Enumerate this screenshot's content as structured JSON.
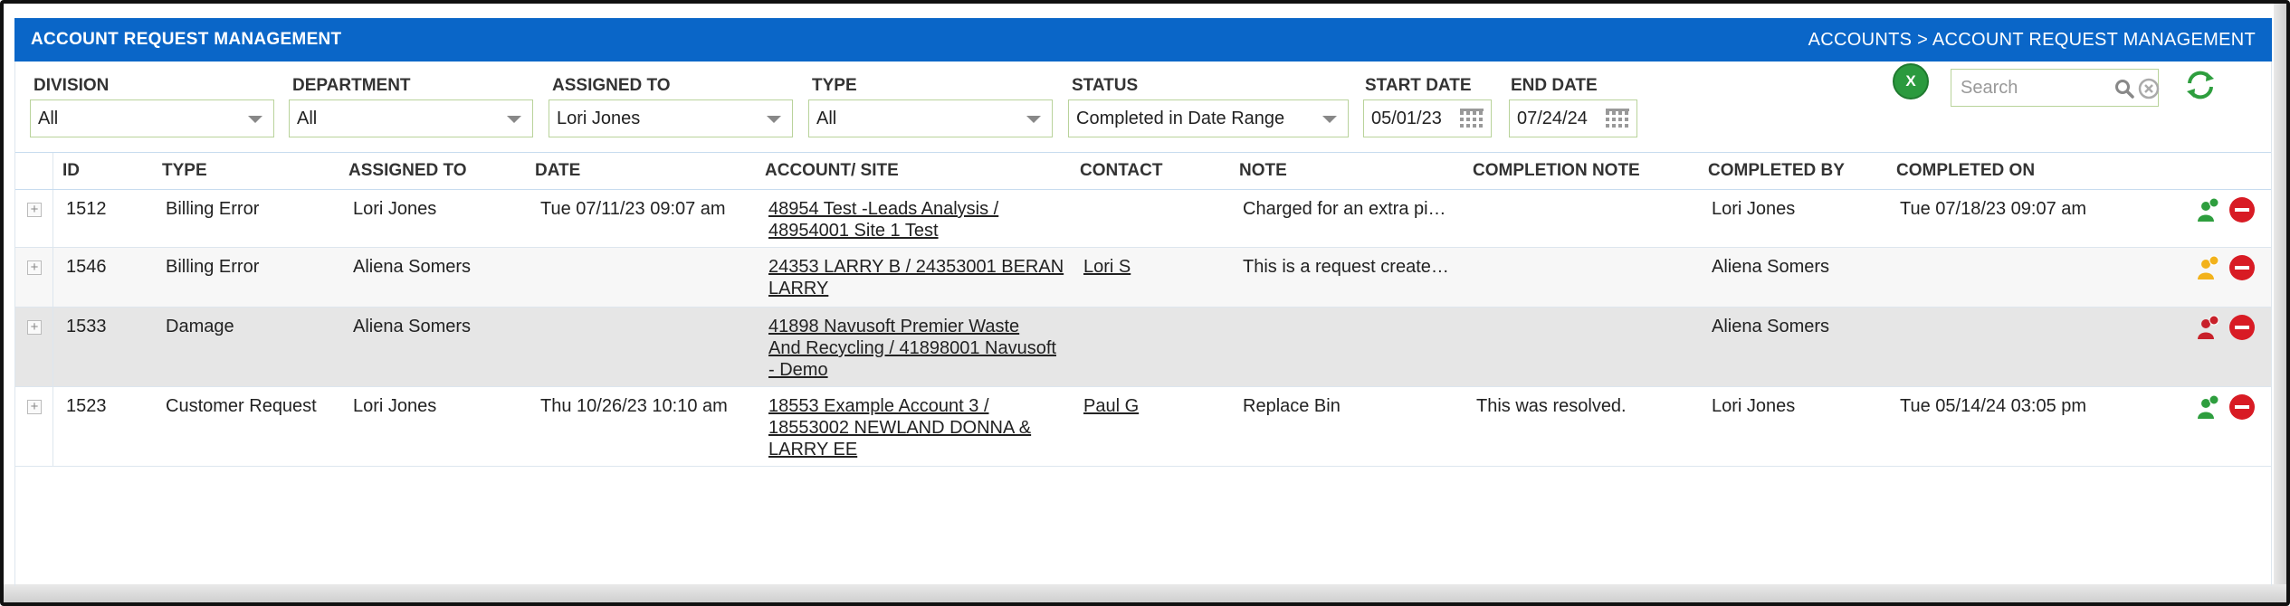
{
  "header": {
    "title": "ACCOUNT REQUEST MANAGEMENT",
    "breadcrumb": [
      "ACCOUNTS",
      ">",
      "ACCOUNT REQUEST MANAGEMENT"
    ]
  },
  "filters": {
    "division": {
      "label": "DIVISION",
      "value": "All"
    },
    "department": {
      "label": "DEPARTMENT",
      "value": "All"
    },
    "assigned_to": {
      "label": "ASSIGNED TO",
      "value": "Lori Jones"
    },
    "type": {
      "label": "TYPE",
      "value": "All"
    },
    "status": {
      "label": "STATUS",
      "value": "Completed in Date Range"
    },
    "start_date": {
      "label": "START DATE",
      "value": "05/01/23"
    },
    "end_date": {
      "label": "END DATE",
      "value": "07/24/24"
    }
  },
  "toolbar": {
    "excel_icon_text": "X",
    "search_placeholder": "Search",
    "icons": {
      "export": "excel-icon",
      "search": "magnifier-icon",
      "clear": "clear-icon",
      "refresh": "refresh-icon"
    }
  },
  "table": {
    "columns": [
      "ID",
      "TYPE",
      "ASSIGNED TO",
      "DATE",
      "ACCOUNT/ SITE",
      "CONTACT",
      "NOTE",
      "COMPLETION NOTE",
      "COMPLETED BY",
      "COMPLETED ON"
    ],
    "rows": [
      {
        "id": "1512",
        "type": "Billing Error",
        "assigned_to": "Lori Jones",
        "date": "Tue 07/11/23 09:07 am",
        "account_lines": [
          "48954 Test -Leads Analysis /",
          "48954001 Site 1 Test"
        ],
        "contact": "",
        "note": "Charged for an extra pi…",
        "completion_note": "",
        "completed_by": "Lori Jones",
        "completed_on": "Tue 07/18/23 09:07 am",
        "user_status_color": "#2e9e3e"
      },
      {
        "id": "1546",
        "type": "Billing Error",
        "assigned_to": "Aliena Somers",
        "date": "",
        "account_lines": [
          "24353 LARRY B / 24353001 BERAN",
          "LARRY"
        ],
        "contact": "Lori S",
        "note": "This is a request create…",
        "completion_note": "",
        "completed_by": "Aliena Somers",
        "completed_on": "",
        "user_status_color": "#f2b21b"
      },
      {
        "id": "1533",
        "type": "Damage",
        "assigned_to": "Aliena Somers",
        "date": "",
        "account_lines": [
          "41898 Navusoft Premier Waste",
          "And Recycling / 41898001 Navusoft",
          "- Demo"
        ],
        "contact": "",
        "note": "",
        "completion_note": "",
        "completed_by": "Aliena Somers",
        "completed_on": "",
        "user_status_color": "#c8202a"
      },
      {
        "id": "1523",
        "type": "Customer Request",
        "assigned_to": "Lori Jones",
        "date": "Thu 10/26/23 10:10 am",
        "account_lines": [
          "18553 Example Account 3 /",
          "18553002 NEWLAND DONNA &",
          "LARRY EE"
        ],
        "contact": "Paul G",
        "note": "Replace Bin",
        "completion_note": "This was resolved.",
        "completed_by": "Lori Jones",
        "completed_on": "Tue 05/14/24 03:05 pm",
        "user_status_color": "#2e9e3e"
      }
    ]
  },
  "colors": {
    "header_bg": "#0a66c8",
    "field_border": "#b9d39b",
    "delete": "#d81b24"
  }
}
